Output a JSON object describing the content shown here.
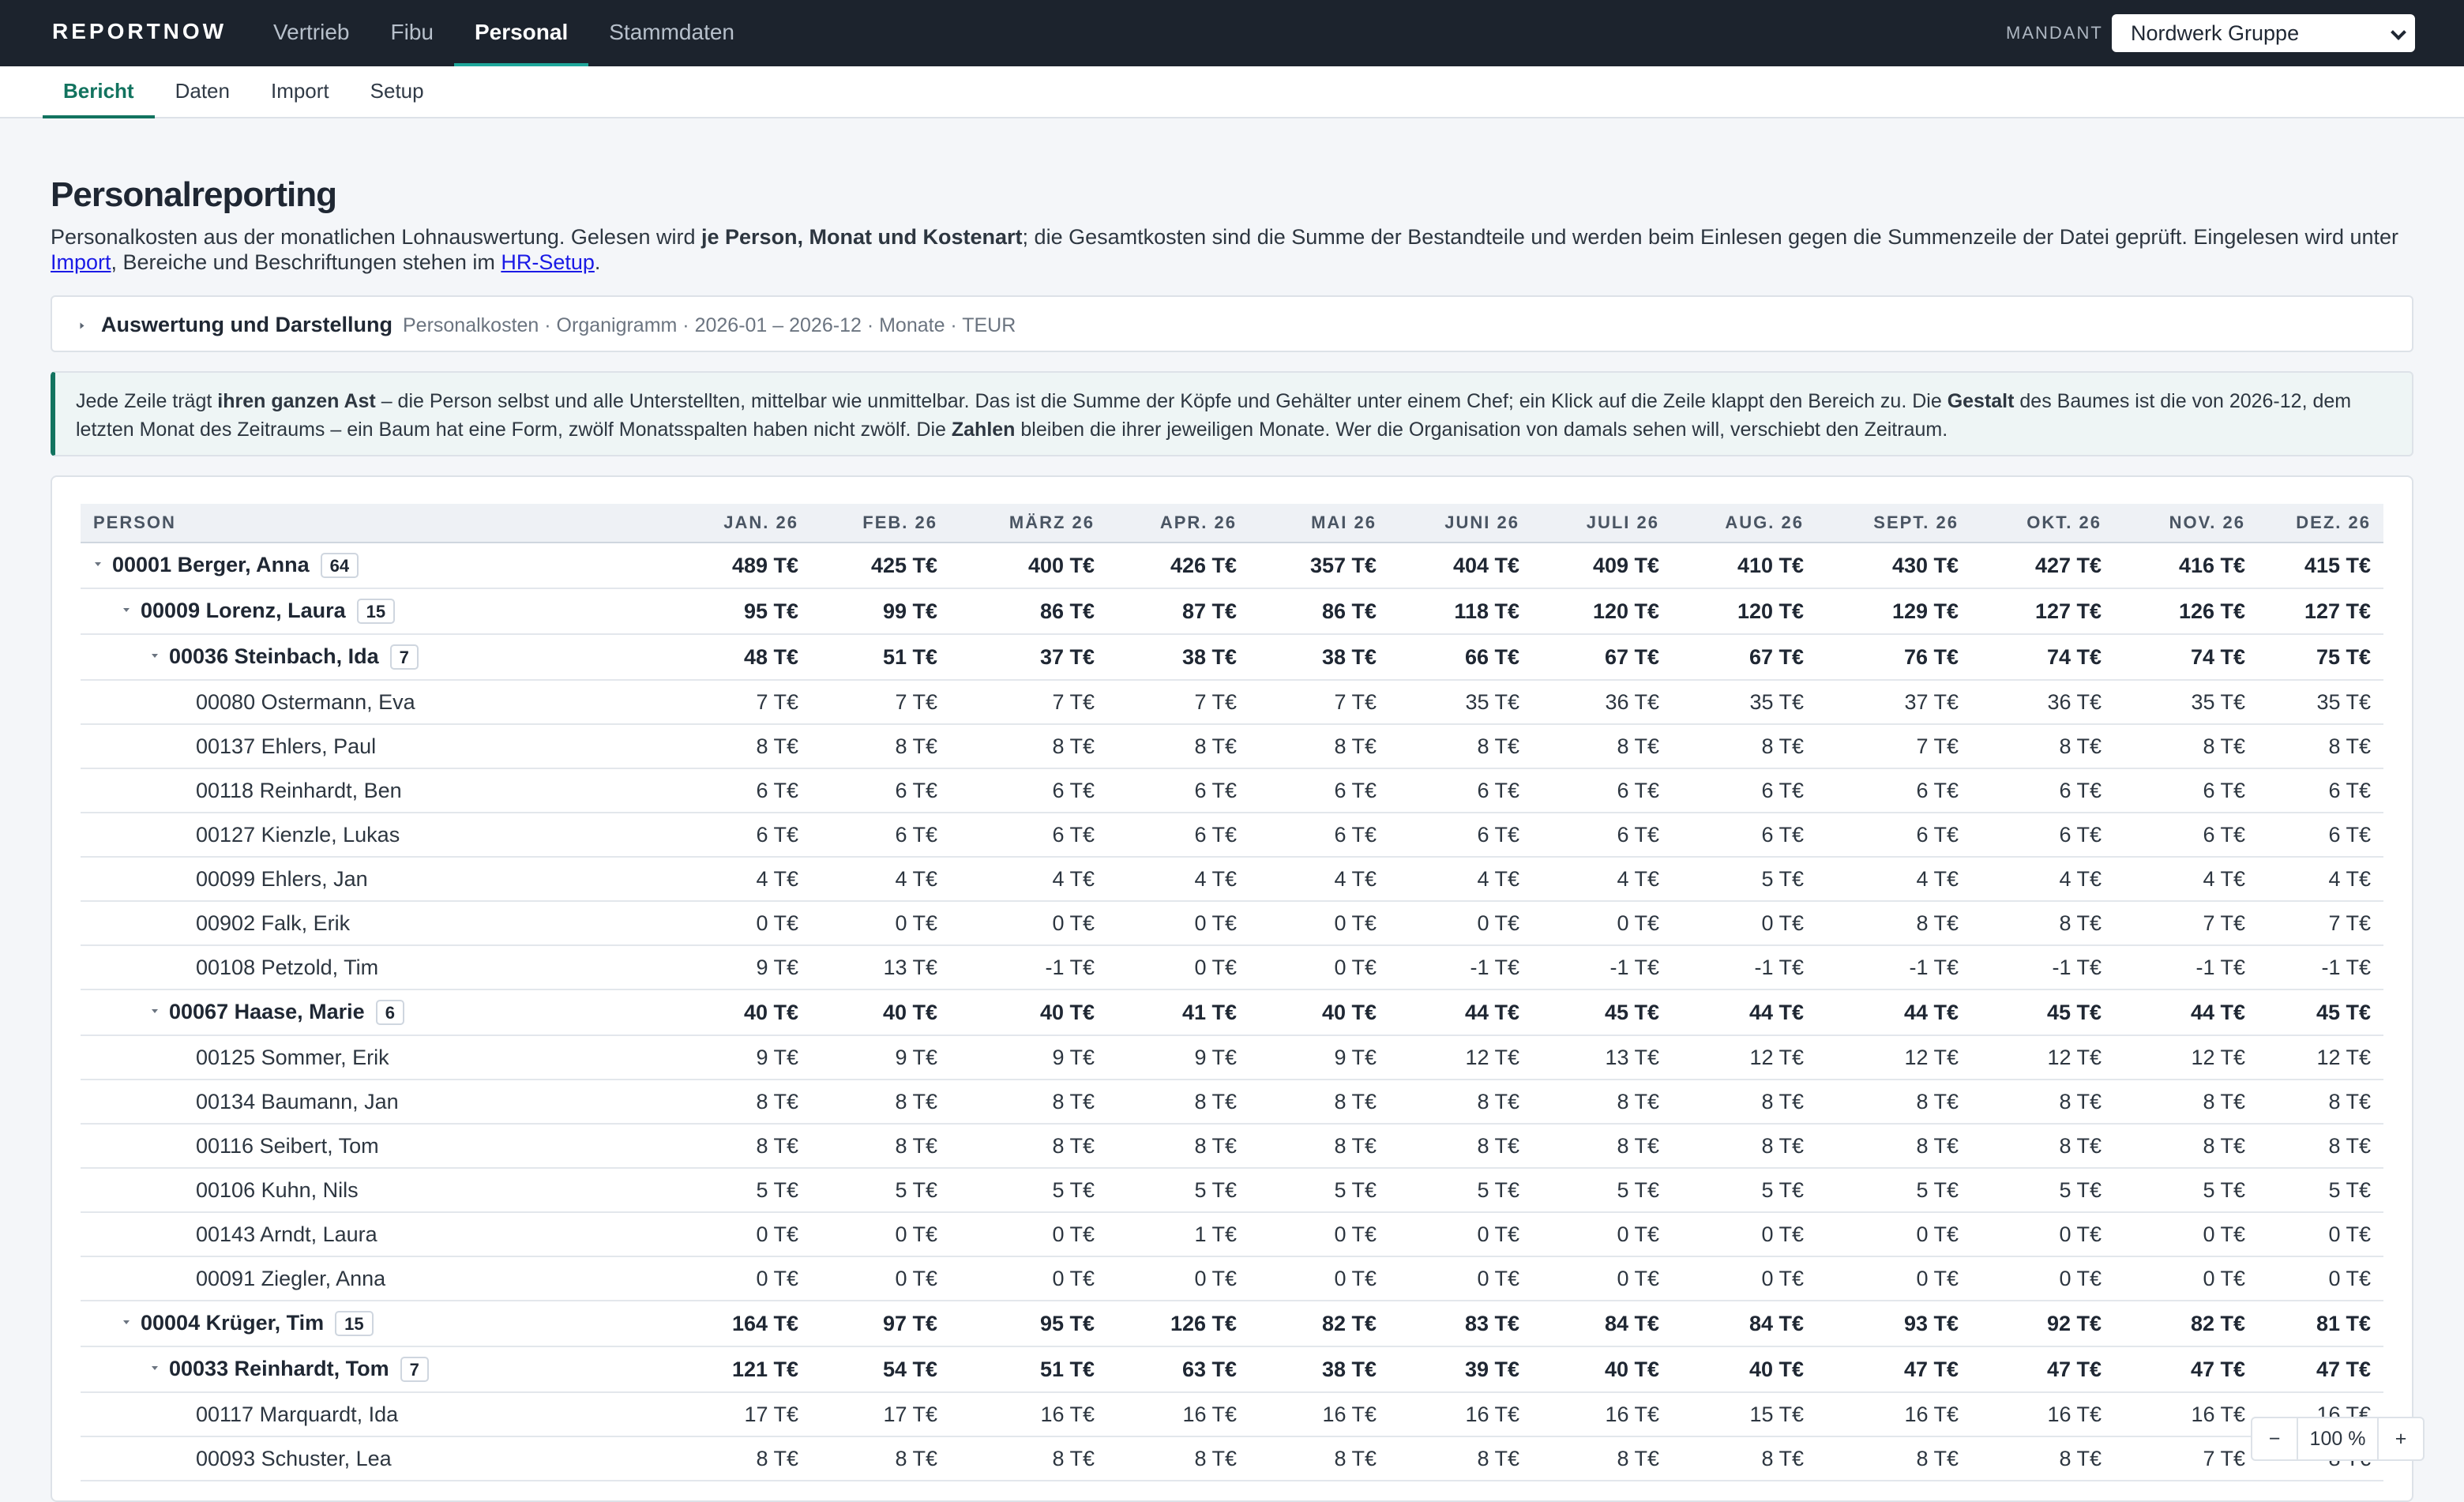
{
  "app": {
    "brand": "REPORTNOW"
  },
  "topnav": {
    "items": [
      {
        "label": "Vertrieb"
      },
      {
        "label": "Fibu"
      },
      {
        "label": "Personal",
        "active": true
      },
      {
        "label": "Stammdaten"
      }
    ]
  },
  "mandant": {
    "label": "MANDANT",
    "value": "Nordwerk Gruppe"
  },
  "subnav": {
    "tabs": [
      {
        "label": "Bericht",
        "active": true
      },
      {
        "label": "Daten"
      },
      {
        "label": "Import"
      },
      {
        "label": "Setup"
      }
    ]
  },
  "page": {
    "title": "Personalreporting",
    "intro": {
      "t1": "Personalkosten aus der monatlichen Lohnauswertung. Gelesen wird ",
      "b1": "je Person, Monat und Kostenart",
      "t2": "; die Gesamtkosten sind die Summe der Bestandteile und werden beim Einlesen gegen die Summenzeile der Datei geprüft. Eingelesen wird unter ",
      "link1": "Import",
      "t3": ", Bereiche und Beschriftungen stehen im ",
      "link2": "HR-Setup",
      "t4": "."
    }
  },
  "settings": {
    "label": "Auswertung und Darstellung",
    "summary": "Personalkosten · Organigramm · 2026-01 – 2026-12 · Monate · TEUR"
  },
  "note": {
    "t1": "Jede Zeile trägt ",
    "b1": "ihren ganzen Ast",
    "t2": " – die Person selbst und alle Unterstellten, mittelbar wie unmittelbar. Das ist die Summe der Köpfe und Gehälter unter einem Chef; ein Klick auf die Zeile klappt den Bereich zu. Die ",
    "b2": "Gestalt",
    "t3": " des Baumes ist die von 2026-12, dem letzten Monat des Zeitraums – ein Baum hat eine Form, zwölf Monatsspalten haben nicht zwölf. Die ",
    "b3": "Zahlen",
    "t4": " bleiben die ihrer jeweiligen Monate. Wer die Organisation von damals sehen will, verschiebt den Zeitraum."
  },
  "table": {
    "columns": [
      "PERSON",
      "JAN. 26",
      "FEB. 26",
      "MÄRZ 26",
      "APR. 26",
      "MAI 26",
      "JUNI 26",
      "JULI 26",
      "AUG. 26",
      "SEPT. 26",
      "OKT. 26",
      "NOV. 26",
      "DEZ. 26"
    ],
    "rows": [
      {
        "name": "00001 Berger, Anna",
        "level": 0,
        "group": true,
        "count": "64",
        "values": [
          "489 T€",
          "425 T€",
          "400 T€",
          "426 T€",
          "357 T€",
          "404 T€",
          "409 T€",
          "410 T€",
          "430 T€",
          "427 T€",
          "416 T€",
          "415 T€"
        ]
      },
      {
        "name": "00009 Lorenz, Laura",
        "level": 1,
        "group": true,
        "count": "15",
        "values": [
          "95 T€",
          "99 T€",
          "86 T€",
          "87 T€",
          "86 T€",
          "118 T€",
          "120 T€",
          "120 T€",
          "129 T€",
          "127 T€",
          "126 T€",
          "127 T€"
        ]
      },
      {
        "name": "00036 Steinbach, Ida",
        "level": 2,
        "group": true,
        "count": "7",
        "values": [
          "48 T€",
          "51 T€",
          "37 T€",
          "38 T€",
          "38 T€",
          "66 T€",
          "67 T€",
          "67 T€",
          "76 T€",
          "74 T€",
          "74 T€",
          "75 T€"
        ]
      },
      {
        "name": "00080 Ostermann, Eva",
        "level": 3,
        "values": [
          "7 T€",
          "7 T€",
          "7 T€",
          "7 T€",
          "7 T€",
          "35 T€",
          "36 T€",
          "35 T€",
          "37 T€",
          "36 T€",
          "35 T€",
          "35 T€"
        ]
      },
      {
        "name": "00137 Ehlers, Paul",
        "level": 3,
        "values": [
          "8 T€",
          "8 T€",
          "8 T€",
          "8 T€",
          "8 T€",
          "8 T€",
          "8 T€",
          "8 T€",
          "7 T€",
          "8 T€",
          "8 T€",
          "8 T€"
        ]
      },
      {
        "name": "00118 Reinhardt, Ben",
        "level": 3,
        "values": [
          "6 T€",
          "6 T€",
          "6 T€",
          "6 T€",
          "6 T€",
          "6 T€",
          "6 T€",
          "6 T€",
          "6 T€",
          "6 T€",
          "6 T€",
          "6 T€"
        ]
      },
      {
        "name": "00127 Kienzle, Lukas",
        "level": 3,
        "values": [
          "6 T€",
          "6 T€",
          "6 T€",
          "6 T€",
          "6 T€",
          "6 T€",
          "6 T€",
          "6 T€",
          "6 T€",
          "6 T€",
          "6 T€",
          "6 T€"
        ]
      },
      {
        "name": "00099 Ehlers, Jan",
        "level": 3,
        "values": [
          "4 T€",
          "4 T€",
          "4 T€",
          "4 T€",
          "4 T€",
          "4 T€",
          "4 T€",
          "5 T€",
          "4 T€",
          "4 T€",
          "4 T€",
          "4 T€"
        ]
      },
      {
        "name": "00902 Falk, Erik",
        "level": 3,
        "values": [
          "0 T€",
          "0 T€",
          "0 T€",
          "0 T€",
          "0 T€",
          "0 T€",
          "0 T€",
          "0 T€",
          "8 T€",
          "8 T€",
          "7 T€",
          "7 T€"
        ]
      },
      {
        "name": "00108 Petzold, Tim",
        "level": 3,
        "values": [
          "9 T€",
          "13 T€",
          "-1 T€",
          "0 T€",
          "0 T€",
          "-1 T€",
          "-1 T€",
          "-1 T€",
          "-1 T€",
          "-1 T€",
          "-1 T€",
          "-1 T€"
        ]
      },
      {
        "name": "00067 Haase, Marie",
        "level": 2,
        "group": true,
        "count": "6",
        "values": [
          "40 T€",
          "40 T€",
          "40 T€",
          "41 T€",
          "40 T€",
          "44 T€",
          "45 T€",
          "44 T€",
          "44 T€",
          "45 T€",
          "44 T€",
          "45 T€"
        ]
      },
      {
        "name": "00125 Sommer, Erik",
        "level": 3,
        "values": [
          "9 T€",
          "9 T€",
          "9 T€",
          "9 T€",
          "9 T€",
          "12 T€",
          "13 T€",
          "12 T€",
          "12 T€",
          "12 T€",
          "12 T€",
          "12 T€"
        ]
      },
      {
        "name": "00134 Baumann, Jan",
        "level": 3,
        "values": [
          "8 T€",
          "8 T€",
          "8 T€",
          "8 T€",
          "8 T€",
          "8 T€",
          "8 T€",
          "8 T€",
          "8 T€",
          "8 T€",
          "8 T€",
          "8 T€"
        ]
      },
      {
        "name": "00116 Seibert, Tom",
        "level": 3,
        "values": [
          "8 T€",
          "8 T€",
          "8 T€",
          "8 T€",
          "8 T€",
          "8 T€",
          "8 T€",
          "8 T€",
          "8 T€",
          "8 T€",
          "8 T€",
          "8 T€"
        ]
      },
      {
        "name": "00106 Kuhn, Nils",
        "level": 3,
        "values": [
          "5 T€",
          "5 T€",
          "5 T€",
          "5 T€",
          "5 T€",
          "5 T€",
          "5 T€",
          "5 T€",
          "5 T€",
          "5 T€",
          "5 T€",
          "5 T€"
        ]
      },
      {
        "name": "00143 Arndt, Laura",
        "level": 3,
        "values": [
          "0 T€",
          "0 T€",
          "0 T€",
          "1 T€",
          "0 T€",
          "0 T€",
          "0 T€",
          "0 T€",
          "0 T€",
          "0 T€",
          "0 T€",
          "0 T€"
        ]
      },
      {
        "name": "00091 Ziegler, Anna",
        "level": 3,
        "values": [
          "0 T€",
          "0 T€",
          "0 T€",
          "0 T€",
          "0 T€",
          "0 T€",
          "0 T€",
          "0 T€",
          "0 T€",
          "0 T€",
          "0 T€",
          "0 T€"
        ]
      },
      {
        "name": "00004 Krüger, Tim",
        "level": 1,
        "group": true,
        "count": "15",
        "values": [
          "164 T€",
          "97 T€",
          "95 T€",
          "126 T€",
          "82 T€",
          "83 T€",
          "84 T€",
          "84 T€",
          "93 T€",
          "92 T€",
          "82 T€",
          "81 T€"
        ]
      },
      {
        "name": "00033 Reinhardt, Tom",
        "level": 2,
        "group": true,
        "count": "7",
        "values": [
          "121 T€",
          "54 T€",
          "51 T€",
          "63 T€",
          "38 T€",
          "39 T€",
          "40 T€",
          "40 T€",
          "47 T€",
          "47 T€",
          "47 T€",
          "47 T€"
        ]
      },
      {
        "name": "00117 Marquardt, Ida",
        "level": 3,
        "values": [
          "17 T€",
          "17 T€",
          "16 T€",
          "16 T€",
          "16 T€",
          "16 T€",
          "16 T€",
          "15 T€",
          "16 T€",
          "16 T€",
          "16 T€",
          "16 T€"
        ]
      },
      {
        "name": "00093 Schuster, Lea",
        "level": 3,
        "values": [
          "8 T€",
          "8 T€",
          "8 T€",
          "8 T€",
          "8 T€",
          "8 T€",
          "8 T€",
          "8 T€",
          "8 T€",
          "8 T€",
          "7 T€",
          "8 T€"
        ]
      }
    ]
  },
  "zoom": {
    "minus": "−",
    "value": "100 %",
    "plus": "+"
  },
  "colors": {
    "topbar": "#1c232d",
    "accent": "#12735f",
    "tab_active_underline": "#1fa79b"
  }
}
